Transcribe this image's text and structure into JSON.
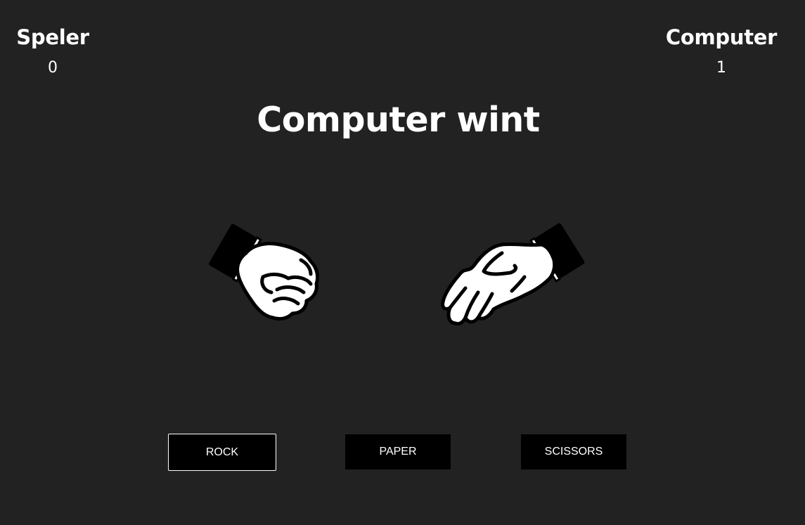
{
  "scoreboard": {
    "player_label": "Speler",
    "player_score": "0",
    "computer_label": "Computer",
    "computer_score": "1"
  },
  "result_text": "Computer wint",
  "hands": {
    "player_choice": "rock",
    "computer_choice": "paper"
  },
  "buttons": {
    "rock": "ROCK",
    "paper": "PAPER",
    "scissors": "SCISSORS",
    "selected": "rock"
  },
  "colors": {
    "background": "#222222",
    "button_bg": "#000000",
    "text": "#ffffff"
  }
}
